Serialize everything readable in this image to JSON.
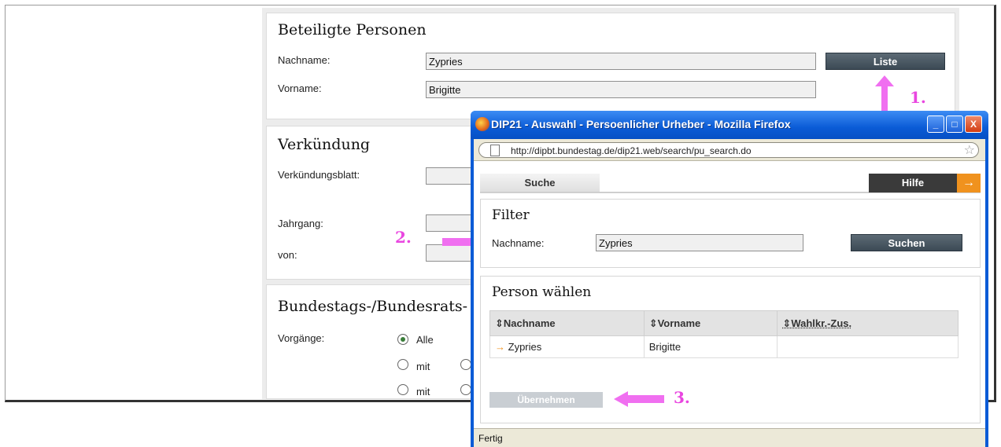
{
  "background_form": {
    "section1": {
      "title": "Beteiligte Personen",
      "lastname_label": "Nachname:",
      "lastname_value": "Zypries",
      "firstname_label": "Vorname:",
      "firstname_value": "Brigitte",
      "list_button": "Liste"
    },
    "section2": {
      "title": "Verkündung",
      "gazette_label": "Verkündungsblatt:",
      "year_label": "Jahrgang:",
      "from_label": "von:"
    },
    "section3": {
      "title": "Bundestags-/Bundesrats-",
      "procedures_label": "Vorgänge:",
      "radio_all": "Alle",
      "radio_with_1": "mit",
      "radio_with_2": "mit"
    }
  },
  "popup": {
    "title": "DIP21 - Auswahl - Persoenlicher Urheber - Mozilla Firefox",
    "url": "http://dipbt.bundestag.de/dip21.web/search/pu_search.do",
    "tab_search": "Suche",
    "help_button": "Hilfe",
    "help_arrow": "→",
    "filter": {
      "title": "Filter",
      "lastname_label": "Nachname:",
      "lastname_value": "Zypries",
      "search_button": "Suchen"
    },
    "results": {
      "title": "Person wählen",
      "columns": [
        "⇕Nachname",
        "⇕Vorname",
        "⇕Wahlkr.-Zus."
      ],
      "rows": [
        {
          "lastname": "Zypries",
          "firstname": "Brigitte",
          "district": ""
        }
      ],
      "row_arrow": "→",
      "apply_button": "Übernehmen"
    },
    "status": "Fertig",
    "window_buttons": {
      "minimize": "_",
      "maximize": "□",
      "close": "X"
    }
  },
  "annotations": {
    "step1": "1.",
    "step2": "2.",
    "step3": "3.",
    "color": "#e946e0"
  },
  "icons": [
    "firefox-icon",
    "page-icon",
    "star-icon",
    "arrow-right-icon",
    "sort-icon"
  ]
}
